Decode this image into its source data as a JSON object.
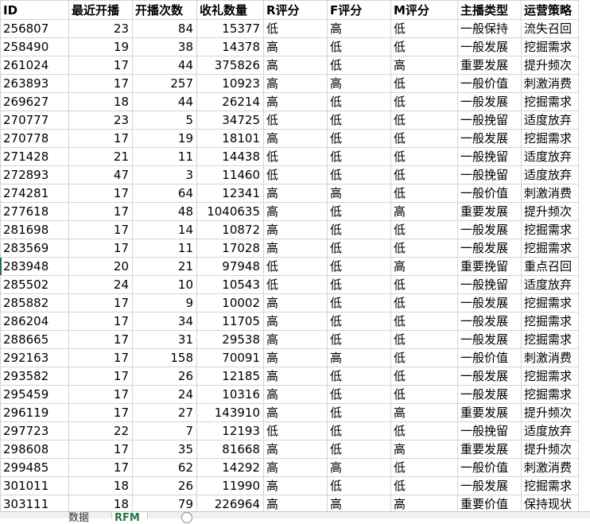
{
  "sheet": {
    "columns": [
      "ID",
      "最近开播时间",
      "开播次数F",
      "收礼数量M",
      "R评分",
      "F评分",
      "M评分",
      "主播类型",
      "运营策略"
    ],
    "header_display": [
      "ID",
      "最近开播",
      "开播次数",
      "收礼数量",
      "R评分",
      "F评分",
      "M评分",
      "主播类型",
      "运营策略"
    ],
    "rows": [
      [
        "256807",
        "23",
        "84",
        "15377",
        "低",
        "高",
        "低",
        "一般保持",
        "流失召回"
      ],
      [
        "258490",
        "19",
        "38",
        "14378",
        "高",
        "低",
        "低",
        "一般发展",
        "挖掘需求"
      ],
      [
        "261024",
        "17",
        "44",
        "375826",
        "高",
        "低",
        "高",
        "重要发展",
        "提升频次"
      ],
      [
        "263893",
        "17",
        "257",
        "10923",
        "高",
        "高",
        "低",
        "一般价值",
        "刺激消费"
      ],
      [
        "269627",
        "18",
        "44",
        "26214",
        "高",
        "低",
        "低",
        "一般发展",
        "挖掘需求"
      ],
      [
        "270777",
        "23",
        "5",
        "34725",
        "低",
        "低",
        "低",
        "一般挽留",
        "适度放弃"
      ],
      [
        "270778",
        "17",
        "19",
        "18101",
        "高",
        "低",
        "低",
        "一般发展",
        "挖掘需求"
      ],
      [
        "271428",
        "21",
        "11",
        "14438",
        "低",
        "低",
        "低",
        "一般挽留",
        "适度放弃"
      ],
      [
        "272893",
        "47",
        "3",
        "11460",
        "低",
        "低",
        "低",
        "一般挽留",
        "适度放弃"
      ],
      [
        "274281",
        "17",
        "64",
        "12341",
        "高",
        "高",
        "低",
        "一般价值",
        "刺激消费"
      ],
      [
        "277618",
        "17",
        "48",
        "1040635",
        "高",
        "低",
        "高",
        "重要发展",
        "提升频次"
      ],
      [
        "281698",
        "17",
        "14",
        "10872",
        "高",
        "低",
        "低",
        "一般发展",
        "挖掘需求"
      ],
      [
        "283569",
        "17",
        "11",
        "17028",
        "高",
        "低",
        "低",
        "一般发展",
        "挖掘需求"
      ],
      [
        "283948",
        "20",
        "21",
        "97948",
        "低",
        "低",
        "高",
        "重要挽留",
        "重点召回"
      ],
      [
        "285502",
        "24",
        "10",
        "10543",
        "低",
        "低",
        "低",
        "一般挽留",
        "适度放弃"
      ],
      [
        "285882",
        "17",
        "9",
        "10002",
        "高",
        "低",
        "低",
        "一般发展",
        "挖掘需求"
      ],
      [
        "286204",
        "17",
        "34",
        "11705",
        "高",
        "低",
        "低",
        "一般发展",
        "挖掘需求"
      ],
      [
        "288665",
        "17",
        "31",
        "29538",
        "高",
        "低",
        "低",
        "一般发展",
        "挖掘需求"
      ],
      [
        "292163",
        "17",
        "158",
        "70091",
        "高",
        "高",
        "低",
        "一般价值",
        "刺激消费"
      ],
      [
        "293582",
        "17",
        "26",
        "12185",
        "高",
        "低",
        "低",
        "一般发展",
        "挖掘需求"
      ],
      [
        "295459",
        "17",
        "24",
        "10316",
        "高",
        "低",
        "低",
        "一般发展",
        "挖掘需求"
      ],
      [
        "296119",
        "17",
        "27",
        "143910",
        "高",
        "低",
        "高",
        "重要发展",
        "提升频次"
      ],
      [
        "297723",
        "22",
        "7",
        "12193",
        "低",
        "低",
        "低",
        "一般挽留",
        "适度放弃"
      ],
      [
        "298608",
        "17",
        "35",
        "81668",
        "高",
        "低",
        "高",
        "重要发展",
        "提升频次"
      ],
      [
        "299485",
        "17",
        "62",
        "14292",
        "高",
        "高",
        "低",
        "一般价值",
        "刺激消费"
      ],
      [
        "301011",
        "18",
        "26",
        "11990",
        "高",
        "低",
        "低",
        "一般发展",
        "挖掘需求"
      ],
      [
        "303111",
        "18",
        "79",
        "226964",
        "高",
        "高",
        "高",
        "重要价值",
        "保持现状"
      ]
    ]
  },
  "tabs": {
    "data_label": "数据",
    "rfm_label": "RFM"
  }
}
